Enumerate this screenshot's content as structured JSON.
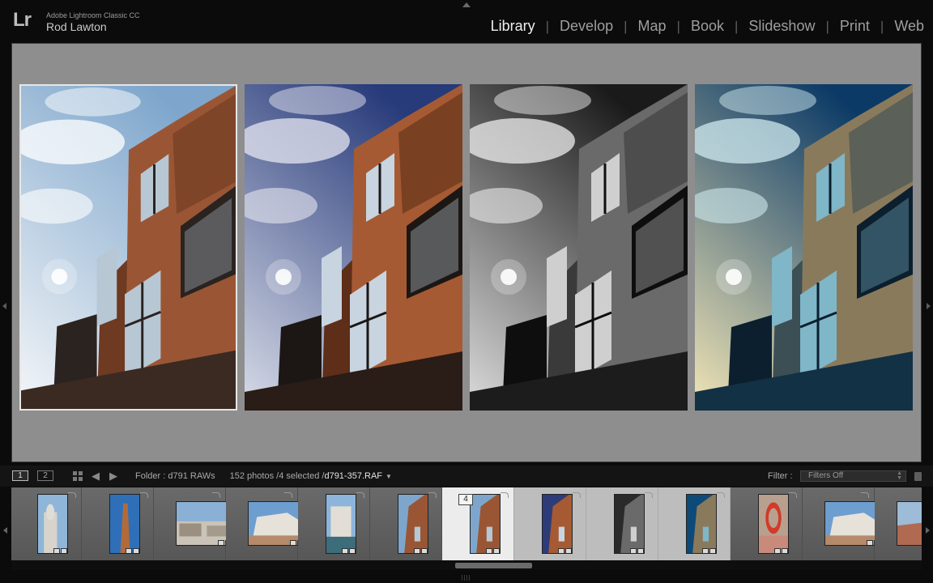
{
  "app": {
    "logo": "Lr",
    "product": "Adobe Lightroom Classic CC",
    "user": "Rod Lawton"
  },
  "modules": [
    {
      "label": "Library",
      "active": true
    },
    {
      "label": "Develop",
      "active": false
    },
    {
      "label": "Map",
      "active": false
    },
    {
      "label": "Book",
      "active": false
    },
    {
      "label": "Slideshow",
      "active": false
    },
    {
      "label": "Print",
      "active": false
    },
    {
      "label": "Web",
      "active": false
    }
  ],
  "survey": {
    "photos": [
      {
        "variant": "natural",
        "selected": true
      },
      {
        "variant": "vivid",
        "selected": false
      },
      {
        "variant": "mono",
        "selected": false
      },
      {
        "variant": "teal",
        "selected": false
      }
    ]
  },
  "filmstrip_header": {
    "view1": "1",
    "view2": "2",
    "folder": "Folder : d791 RAWs",
    "count": "152 photos /4 selected /",
    "filename": "d791-357.RAF",
    "filter_label": "Filter :",
    "filter_value": "Filters Off"
  },
  "filmstrip": {
    "selected_number": "4",
    "thumbs": [
      {
        "kind": "statue",
        "state": "normal"
      },
      {
        "kind": "tower",
        "state": "normal"
      },
      {
        "kind": "street",
        "state": "normal"
      },
      {
        "kind": "apartments",
        "state": "normal"
      },
      {
        "kind": "harbour",
        "state": "normal"
      },
      {
        "kind": "building",
        "state": "normal"
      },
      {
        "kind": "building",
        "state": "primary"
      },
      {
        "kind": "building-vivid",
        "state": "sel"
      },
      {
        "kind": "building-mono",
        "state": "sel"
      },
      {
        "kind": "building-teal",
        "state": "sel"
      },
      {
        "kind": "lifebuoy",
        "state": "normal"
      },
      {
        "kind": "apartments",
        "state": "normal"
      },
      {
        "kind": "pier",
        "state": "normal"
      }
    ]
  },
  "colors": {
    "background": "#0b0b0b",
    "work_area": "#8e8e8e",
    "active_module": "#efefef",
    "inactive_module": "#9e9e9e"
  }
}
